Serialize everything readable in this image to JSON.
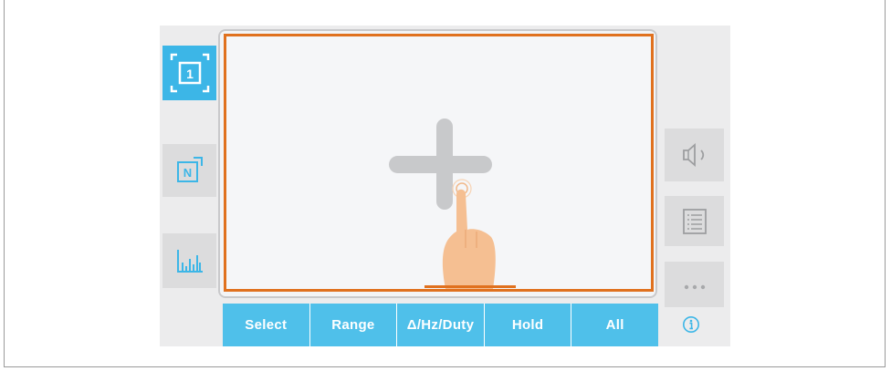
{
  "toolbar": {
    "buttons": [
      {
        "label": "Select"
      },
      {
        "label": "Range"
      },
      {
        "label": "Δ/Hz/Duty"
      },
      {
        "label": "Hold"
      },
      {
        "label": "All"
      }
    ]
  },
  "left_sidebar": {
    "single_view_label": "1",
    "n_view_label": "N"
  },
  "colors": {
    "accent": "#3cb6e7",
    "toolbar_bg": "#4fc0ea",
    "highlight": "#e0711f",
    "button_bg": "#dcdcdd"
  }
}
